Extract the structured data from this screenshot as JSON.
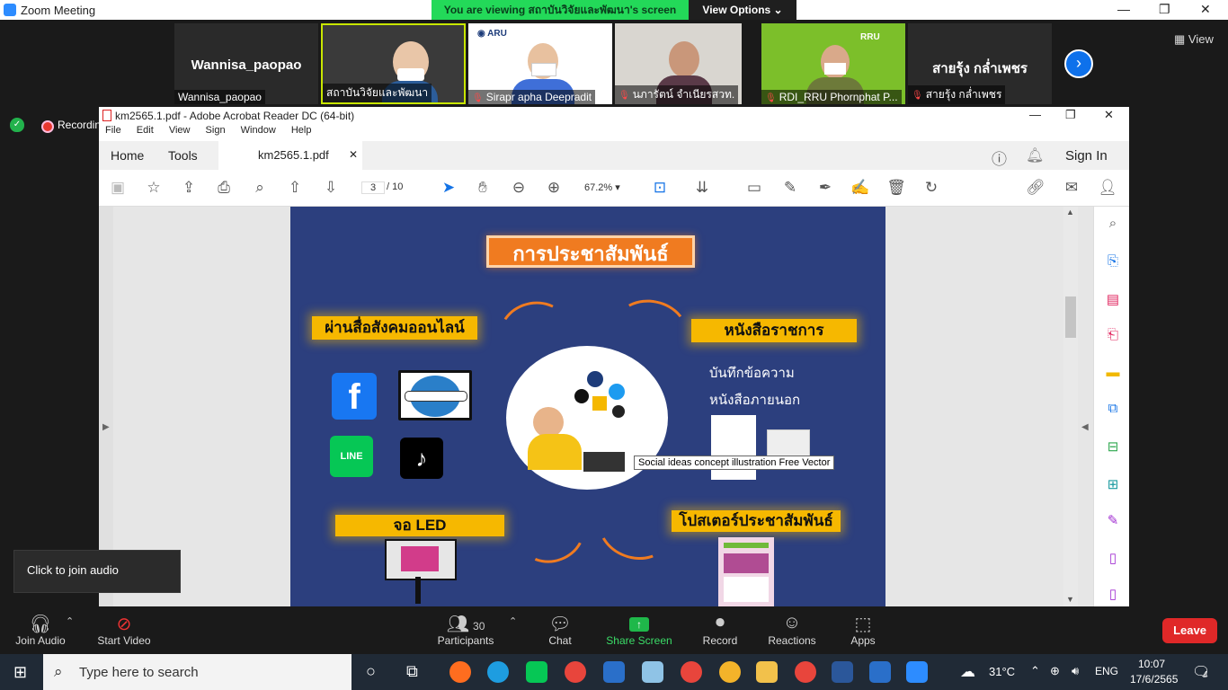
{
  "zoom": {
    "window_title": "Zoom Meeting",
    "banner": "You are viewing สถาบันวิจัยและพัฒนา's screen",
    "view_options": "View Options ⌄",
    "view_label": "View",
    "recording": "Recordin",
    "join_audio_popup": "Click to join audio",
    "participants": [
      {
        "big_name": "Wannisa_paopao",
        "name": "Wannisa_paopao",
        "muted": false
      },
      {
        "name": "สถาบันวิจัยและพัฒนา",
        "muted": false
      },
      {
        "name": "Sirapr apha Deepradit",
        "muted": true
      },
      {
        "name": "นภารัตน์ จำเนียรสวท.",
        "muted": true
      },
      {
        "name": "RDI_RRU Phornphat P...",
        "muted": true
      },
      {
        "big_name": "สายรุ้ง กล่ำเพชร",
        "name": "สายรุ้ง กล่ำเพชร",
        "muted": true
      }
    ],
    "controls": {
      "join_audio": "Join Audio",
      "start_video": "Start Video",
      "participants": "Participants",
      "participants_count": "30",
      "chat": "Chat",
      "share_screen": "Share Screen",
      "record": "Record",
      "reactions": "Reactions",
      "apps": "Apps",
      "leave": "Leave"
    }
  },
  "acrobat": {
    "window_title": "km2565.1.pdf - Adobe Acrobat Reader DC (64-bit)",
    "menu": [
      "File",
      "Edit",
      "View",
      "Sign",
      "Window",
      "Help"
    ],
    "tabs": {
      "home": "Home",
      "tools": "Tools",
      "doc": "km2565.1.pdf"
    },
    "sign_in": "Sign In",
    "page_current": "3",
    "page_total": "/ 10",
    "zoom": "67.2%"
  },
  "slide": {
    "title": "การประชาสัมพันธ์",
    "social": "ผ่านสื่อสังคมออนไลน์",
    "official": "หนังสือราชการ",
    "memo1": "บันทึกข้อความ",
    "memo2": "หนังสือภายนอก",
    "led": "จอ LED",
    "poster": "โปสเตอร์ประชาสัมพันธ์",
    "line_label": "LINE",
    "fb_label": "f",
    "tooltip": "Social ideas concept illustration Free Vector"
  },
  "taskbar": {
    "search_placeholder": "Type here to search",
    "temperature": "31°C",
    "language": "ENG",
    "time": "10:07",
    "date": "17/6/2565",
    "notifications": "4"
  }
}
